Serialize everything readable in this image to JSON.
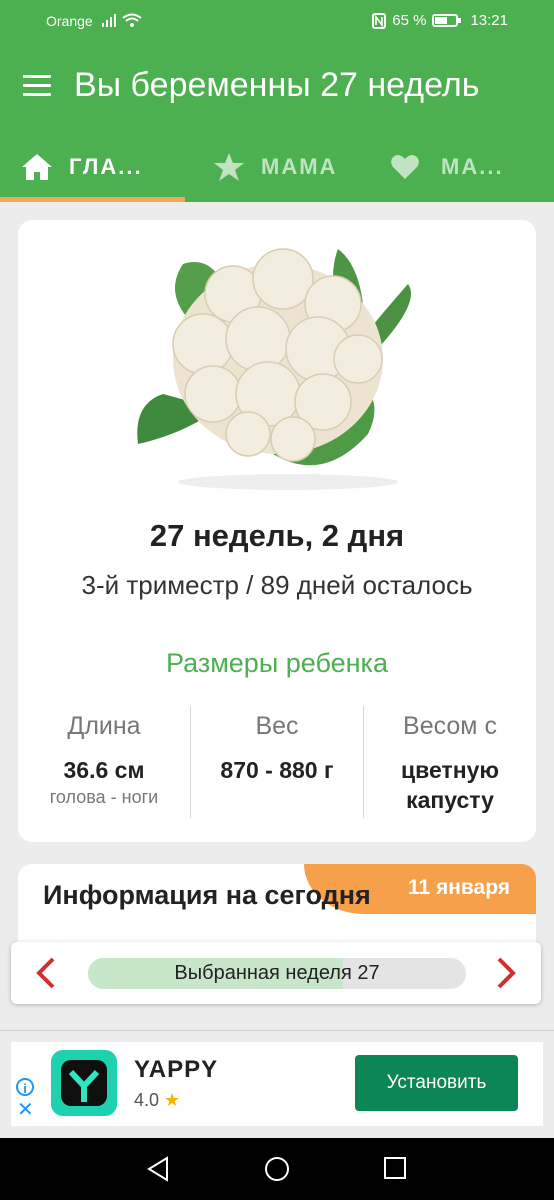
{
  "status_bar": {
    "carrier": "Orange",
    "battery": "65 %",
    "time": "13:21",
    "battery_level": 0.65
  },
  "app_bar": {
    "title": "Вы беременны 27 недель"
  },
  "tabs": [
    {
      "label": "ГЛА...",
      "icon": "home-icon",
      "active": true
    },
    {
      "label": "МАМА",
      "icon": "star-icon",
      "active": false
    },
    {
      "label": "МА...",
      "icon": "heart-icon",
      "active": false
    }
  ],
  "summary": {
    "week_line": "27 недель, 2 дня",
    "trimester_line": "3-й триместр / 89 дней осталось",
    "sizes_title": "Размеры ребенка",
    "length": {
      "label": "Длина",
      "value": "36.6 см",
      "sub": "голова - ноги"
    },
    "weight": {
      "label": "Вес",
      "value": "870 - 880 г"
    },
    "compare": {
      "label": "Весом с",
      "value_line1": "цветную",
      "value_line2": "капусту"
    }
  },
  "info": {
    "title": "Информация на сегодня",
    "date": "11 января"
  },
  "week_selector": {
    "label": "Выбранная неделя 27",
    "progress": 0.675
  },
  "ad": {
    "app_name": "YAPPY",
    "rating": "4.0",
    "install_label": "Установить"
  },
  "colors": {
    "primary": "#4caf50",
    "accent": "#f7a04b",
    "arrow": "#d32f2f",
    "install": "#0b8654"
  }
}
